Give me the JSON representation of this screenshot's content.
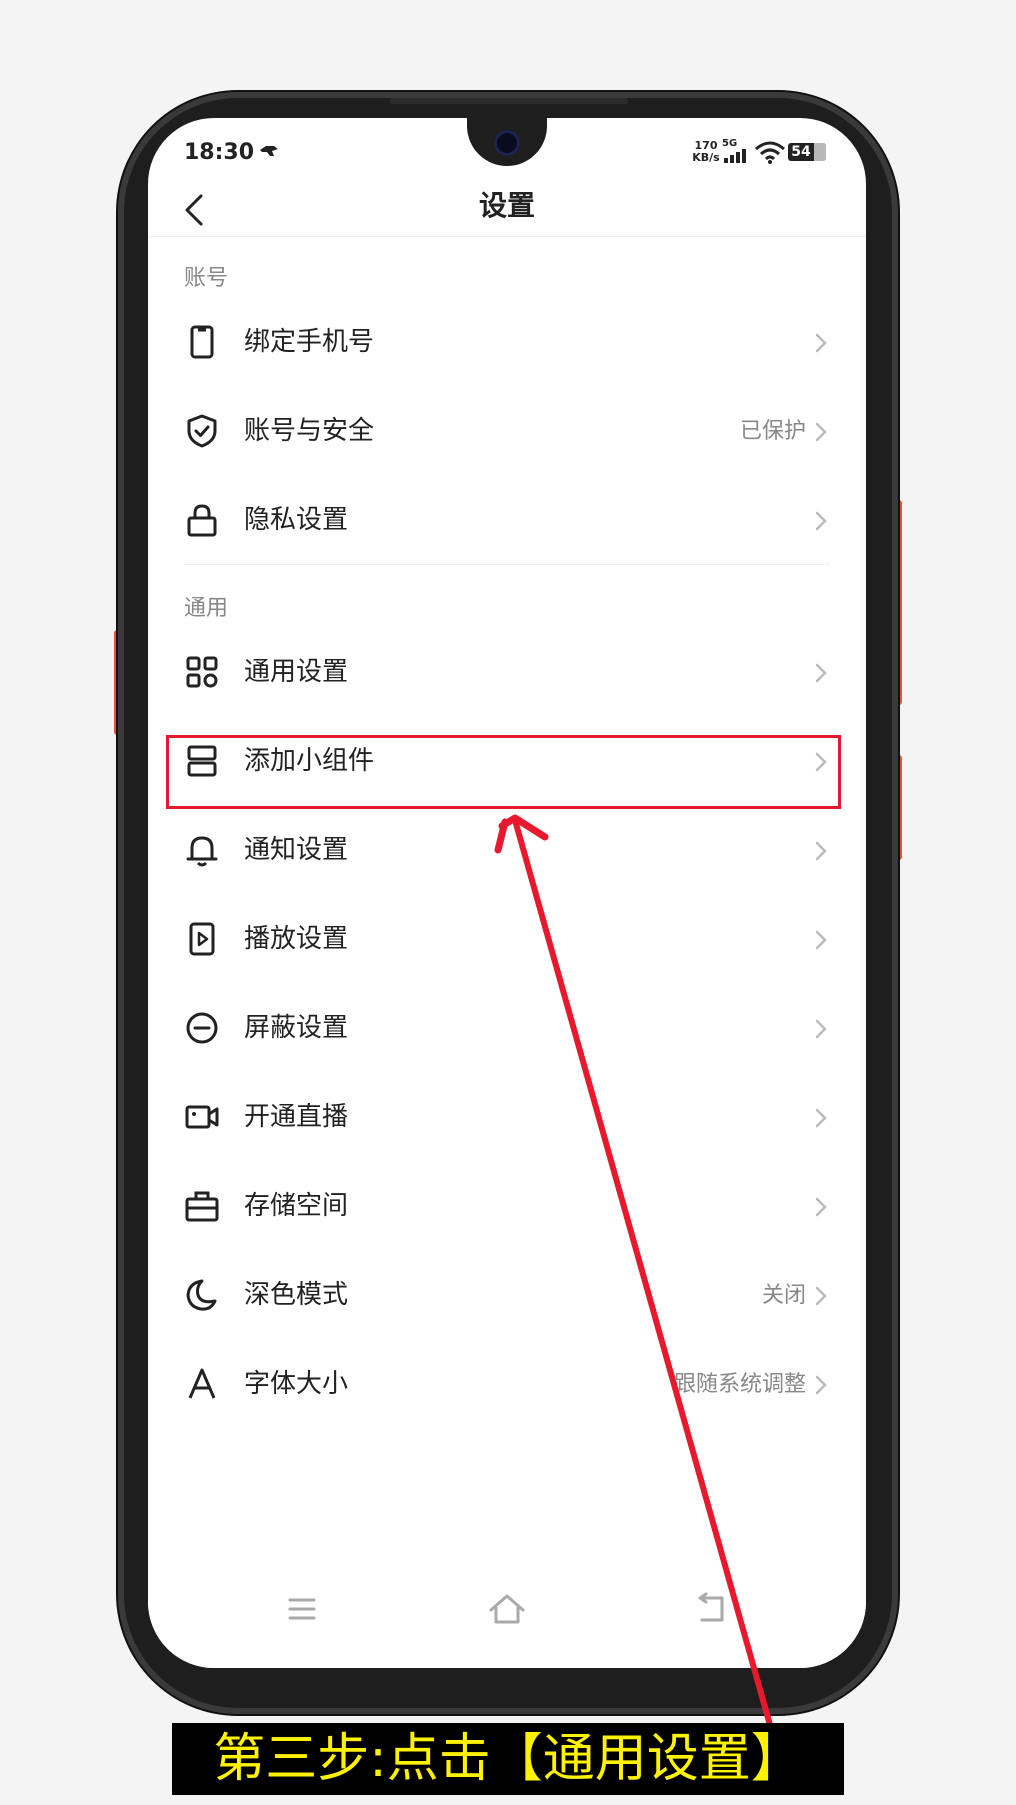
{
  "status_bar": {
    "time": "18:30",
    "network_speed_value": "170",
    "network_speed_unit": "KB/s",
    "network_type": "5G",
    "battery": "54"
  },
  "header": {
    "title": "设置"
  },
  "sections": [
    {
      "title": "账号",
      "items": [
        {
          "label": "绑定手机号",
          "value": "",
          "icon": "phone-icon"
        },
        {
          "label": "账号与安全",
          "value": "已保护",
          "icon": "shield-check-icon"
        },
        {
          "label": "隐私设置",
          "value": "",
          "icon": "lock-icon"
        }
      ]
    },
    {
      "title": "通用",
      "items": [
        {
          "label": "通用设置",
          "value": "",
          "icon": "grid-icon"
        },
        {
          "label": "添加小组件",
          "value": "",
          "icon": "widget-icon"
        },
        {
          "label": "通知设置",
          "value": "",
          "icon": "bell-icon"
        },
        {
          "label": "播放设置",
          "value": "",
          "icon": "play-icon"
        },
        {
          "label": "屏蔽设置",
          "value": "",
          "icon": "block-icon"
        },
        {
          "label": "开通直播",
          "value": "",
          "icon": "camera-icon"
        },
        {
          "label": "存储空间",
          "value": "",
          "icon": "storage-icon"
        },
        {
          "label": "深色模式",
          "value": "关闭",
          "icon": "moon-icon"
        },
        {
          "label": "字体大小",
          "value": "跟随系统调整",
          "icon": "font-icon"
        }
      ]
    }
  ],
  "caption": "第三步:点击【通用设置】",
  "colors": {
    "highlight": "#e8192c",
    "caption_text": "#fff200",
    "caption_bg": "#000000"
  }
}
